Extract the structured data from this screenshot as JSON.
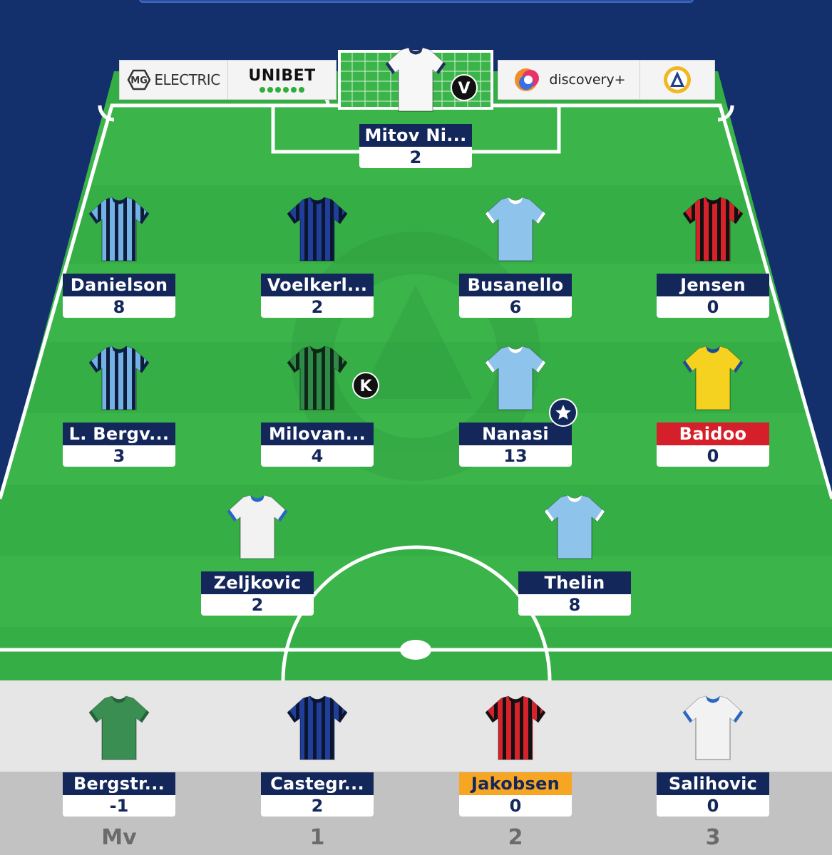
{
  "colors": {
    "background": "#14306c",
    "pitch_light": "#3bb54a",
    "pitch_dark": "#32a843",
    "name_bar": "#13275a",
    "injured": "#d51f2b",
    "doubtful": "#f6a623"
  },
  "sponsors": {
    "left": [
      {
        "name": "ELECTRIC",
        "icon": "mg-logo-icon"
      },
      {
        "name": "UNIBET",
        "icon": "unibet-dots-icon"
      }
    ],
    "right": [
      {
        "name": "discovery+",
        "icon": "discovery-logo-icon"
      },
      {
        "name": "",
        "icon": "allsvenskan-logo-icon"
      }
    ]
  },
  "lineup": {
    "goalkeeper": [
      {
        "name": "Mitov Ni...",
        "points": "2",
        "badge": "V",
        "shirt": "white-navy"
      }
    ],
    "defenders": [
      {
        "name": "Danielson",
        "points": "8",
        "shirt": "blue-stripes"
      },
      {
        "name": "Voelkerl...",
        "points": "2",
        "shirt": "navy-stripes"
      },
      {
        "name": "Busanello",
        "points": "6",
        "shirt": "sky-blue"
      },
      {
        "name": "Jensen",
        "points": "0",
        "shirt": "red-black"
      }
    ],
    "midfielders": [
      {
        "name": "L. Bergv...",
        "points": "3",
        "shirt": "blue-stripes"
      },
      {
        "name": "Milovan...",
        "points": "4",
        "badge": "K",
        "shirt": "green-black"
      },
      {
        "name": "Nanasi",
        "points": "13",
        "badge": "star",
        "shirt": "sky-blue"
      },
      {
        "name": "Baidoo",
        "points": "0",
        "status": "injured",
        "shirt": "yellow"
      }
    ],
    "forwards": [
      {
        "name": "Zeljkovic",
        "points": "2",
        "shirt": "white-blue"
      },
      {
        "name": "Thelin",
        "points": "8",
        "shirt": "sky-blue"
      }
    ]
  },
  "bench": [
    {
      "name": "Bergstr...",
      "points": "-1",
      "label": "Mv",
      "shirt": "green"
    },
    {
      "name": "Castegr...",
      "points": "2",
      "label": "1",
      "shirt": "navy-stripes"
    },
    {
      "name": "Jakobsen",
      "points": "0",
      "label": "2",
      "status": "doubtful",
      "shirt": "red-black"
    },
    {
      "name": "Salihovic",
      "points": "0",
      "label": "3",
      "shirt": "white-blue"
    }
  ]
}
